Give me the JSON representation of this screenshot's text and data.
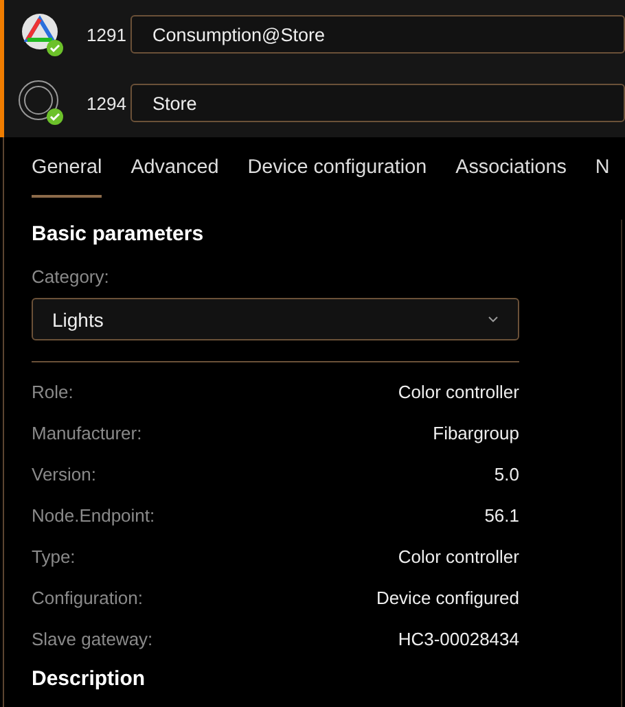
{
  "devices": [
    {
      "kind": "rgb",
      "id": "1291",
      "name": "Consumption@Store",
      "selected": true,
      "online": true
    },
    {
      "kind": "ring",
      "id": "1294",
      "name": "Store",
      "selected": true,
      "online": true
    }
  ],
  "tabs": [
    {
      "label": "General",
      "selected": true
    },
    {
      "label": "Advanced",
      "selected": false
    },
    {
      "label": "Device configuration",
      "selected": false
    },
    {
      "label": "Associations",
      "selected": false
    },
    {
      "label": "N",
      "selected": false
    }
  ],
  "basic_parameters": {
    "title": "Basic parameters",
    "category_label": "Category:",
    "category_value": "Lights",
    "rows": [
      {
        "label": "Role:",
        "value": "Color controller"
      },
      {
        "label": "Manufacturer:",
        "value": "Fibargroup"
      },
      {
        "label": "Version:",
        "value": "5.0"
      },
      {
        "label": "Node.Endpoint:",
        "value": "56.1"
      },
      {
        "label": "Type:",
        "value": "Color controller"
      },
      {
        "label": "Configuration:",
        "value": "Device configured"
      },
      {
        "label": "Slave gateway:",
        "value": "HC3-00028434"
      }
    ]
  },
  "description": {
    "title": "Description"
  }
}
